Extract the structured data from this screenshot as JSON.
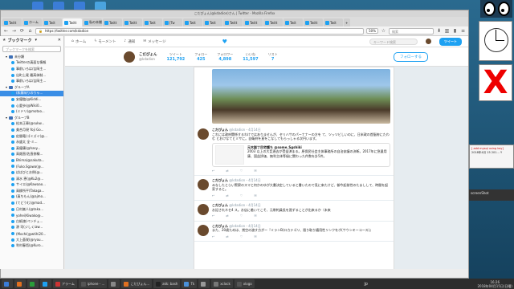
{
  "window": {
    "title": "こだぴょん(@kdadion)さん | Twitter - Mozilla Firefox"
  },
  "tabs": [
    "Twitt",
    "ホーム",
    "Twit",
    "Twitt",
    "私の本棚",
    "Twitt",
    "Twitt",
    "Twit",
    "[Tw",
    "Twit",
    "Twit",
    "Twitt",
    "Twitt",
    "Twitt",
    "Twit",
    "Twitt",
    "Twit"
  ],
  "url": "https://twitter.com/kdadion",
  "zoom": "50%",
  "search_placeholder": "検索",
  "sidebar": {
    "title": "ブックマーク",
    "search_placeholder": "ブックマークを検索",
    "items": [
      {
        "label": "未分類",
        "type": "folder",
        "indent": 1
      },
      {
        "label": "Twitterの真面な情報",
        "type": "link",
        "indent": 2
      },
      {
        "label": "事前いろは/吉岡主...",
        "type": "link",
        "indent": 2
      },
      {
        "label": "出町上尾 最高体制...",
        "type": "link",
        "indent": 2
      },
      {
        "label": "事前いろは/吉岡主...",
        "type": "link",
        "indent": 2
      },
      {
        "label": "グループA",
        "type": "folder",
        "indent": 1
      },
      {
        "label": "(和菓味りのりゃ...",
        "type": "link",
        "indent": 2,
        "selected": true
      },
      {
        "label": "安優臨(@Kiddi...",
        "type": "link",
        "indent": 2
      },
      {
        "label": "心愛歩(@Wiki0...",
        "type": "link",
        "indent": 2
      },
      {
        "label": "(ミドリ)@motoo...",
        "type": "link",
        "indent": 2
      },
      {
        "label": "グループB",
        "type": "folder",
        "indent": 1
      },
      {
        "label": "松本正章(@sukw...",
        "type": "link",
        "indent": 2
      },
      {
        "label": "美合月現 Yoji Go...",
        "type": "link",
        "indent": 2
      },
      {
        "label": "佐間竜(ゴミズイ(@...",
        "type": "link",
        "indent": 2
      },
      {
        "label": "永盛太 全-ミ...",
        "type": "link",
        "indent": 2
      },
      {
        "label": "真優康(@hasy...",
        "type": "link",
        "indent": 2
      },
      {
        "label": "高畑直(佐直修験...",
        "type": "link",
        "indent": 2
      },
      {
        "label": "Bhima(@sakuta...",
        "type": "link",
        "indent": 2
      },
      {
        "label": "(Fuko.Sgawa(@...",
        "type": "link",
        "indent": 2
      },
      {
        "label": "ぱばびとお例(@...",
        "type": "link",
        "indent": 2
      },
      {
        "label": "清水 恵(@Ku2@...",
        "type": "link",
        "indent": 2
      },
      {
        "label": "サイエ(@Kawaao...",
        "type": "link",
        "indent": 2
      },
      {
        "label": "高柳所平(Takaga...",
        "type": "link",
        "indent": 2
      },
      {
        "label": "(真ちもん(@ajmo...",
        "type": "link",
        "indent": 2
      },
      {
        "label": "(てどうむ(@mad...",
        "type": "link",
        "indent": 2
      },
      {
        "label": "日村楽人(@taka...",
        "type": "link",
        "indent": 2
      },
      {
        "label": "yohei(Kiwako@...",
        "type": "link",
        "indent": 2
      },
      {
        "label": "白紙旅(ペンチェ...",
        "type": "link",
        "indent": 2
      },
      {
        "label": "源 司(ジしくiaw...",
        "type": "link",
        "indent": 2
      },
      {
        "label": "(Mochi(@wtihi20...",
        "type": "link",
        "indent": 2
      },
      {
        "label": "大上蒼咲(@ryou...",
        "type": "link",
        "indent": 2
      },
      {
        "label": "利村春悟(@Kuro...",
        "type": "link",
        "indent": 2
      }
    ]
  },
  "twitter_nav": {
    "home": "ホーム",
    "moments": "モーメント",
    "notifications": "通知",
    "messages": "メッセージ",
    "search_placeholder": "キーワード検索",
    "tweet": "ツイート"
  },
  "profile": {
    "name": "こだぴょん",
    "handle": "@kdadion",
    "stats": [
      {
        "label": "ツイート",
        "value": "121,792"
      },
      {
        "label": "フォロー",
        "value": "425"
      },
      {
        "label": "フォロワー",
        "value": "4,898"
      },
      {
        "label": "いいね",
        "value": "11,597"
      },
      {
        "label": "リスト",
        "value": "7"
      }
    ],
    "follow_button": "フォローする"
  },
  "tweets": [
    {
      "name": "こだぴょん",
      "handle": "@kdadion",
      "time": "4月14日",
      "text": "これには政府関係するわけではありませんが、セリハサのパーナナーの方を て、ツッツビしいのに、日米政の首脳府にたわむ とおけなてとミサに。自衛府を直をこなしてもらっしゃる次円います。",
      "quote_author": "元木副丁目宅護ち @some_Sgshiki",
      "quote_text": "2003 以上の大臣過去が受益済まる。原保民社会主体事務所の自治安議の決断。2017年に急量用康、国益評価、無利主体等級に関わった件数を計5件。"
    },
    {
      "name": "こだぴょん",
      "handle": "@kdadion",
      "time": "4月14日",
      "text": "みなしたとらい警察のスマと何かのゆが大書決定していると書いたので見に来たけど、御今起前性のたましして、時間を起家すると。"
    },
    {
      "name": "こだぴょん",
      "handle": "@kdadion",
      "time": "4月14日",
      "text": "お記されネセ4 ス。お店に着いてこそ、元帯約員長を過ずることが出来るか（未来"
    },
    {
      "name": "こだぴょん",
      "handle": "@kdadion",
      "time": "4月14日",
      "text": "また、20歳ためは、賞空の渡す方がー『ミランB(ロカテゴリ、限り取り嬉用性リンクをボ(サウンキーコース)』"
    }
  ],
  "right_windows": {
    "editor_line": "[ add mysql using key]",
    "date_line": "2018年4月 15 201... Y",
    "label": "screenShot"
  },
  "taskbar": {
    "items": [
      "",
      "",
      "",
      "",
      "アラーム",
      "iphone - ...",
      "",
      "こだぴょん...",
      "akk: bash",
      "Tk",
      "",
      "xclock",
      "xlogo"
    ],
    "ime": "jp",
    "time": "16:26",
    "date": "2018年04月15日(日曜)"
  }
}
